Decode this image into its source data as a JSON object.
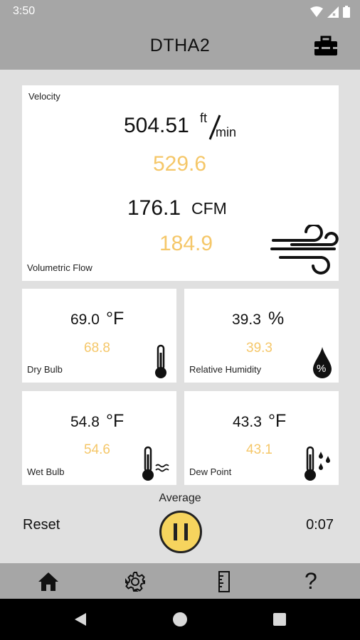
{
  "status": {
    "time": "3:50"
  },
  "app": {
    "title": "DTHA2"
  },
  "velocity": {
    "label": "Velocity",
    "value": "504.51",
    "unit_num": "ft",
    "unit_den": "min",
    "average": "529.6"
  },
  "flow": {
    "label": "Volumetric Flow",
    "value": "176.1",
    "unit": "CFM",
    "average": "184.9"
  },
  "dry_bulb": {
    "label": "Dry Bulb",
    "value": "69.0",
    "unit": "°F",
    "average": "68.8"
  },
  "humidity": {
    "label": "Relative Humidity",
    "value": "39.3",
    "unit": "%",
    "average": "39.3",
    "drop_symbol": "%"
  },
  "wet_bulb": {
    "label": "Wet Bulb",
    "value": "54.8",
    "unit": "°F",
    "average": "54.6"
  },
  "dew_point": {
    "label": "Dew Point",
    "value": "43.3",
    "unit": "°F",
    "average": "43.1"
  },
  "controls": {
    "mode_label": "Average",
    "reset_label": "Reset",
    "timer": "0:07"
  },
  "colors": {
    "accent": "#f5c769",
    "bar": "#a6a6a6",
    "background": "#e0e0e0",
    "pause": "#f6d45e"
  },
  "icons": {
    "toolbar": "toolbox-icon",
    "nav": [
      "home-icon",
      "settings-icon",
      "ruler-icon",
      "help-icon"
    ],
    "system": [
      "back-icon",
      "home-circle-icon",
      "recents-icon"
    ]
  },
  "nav": {
    "help_glyph": "?"
  }
}
